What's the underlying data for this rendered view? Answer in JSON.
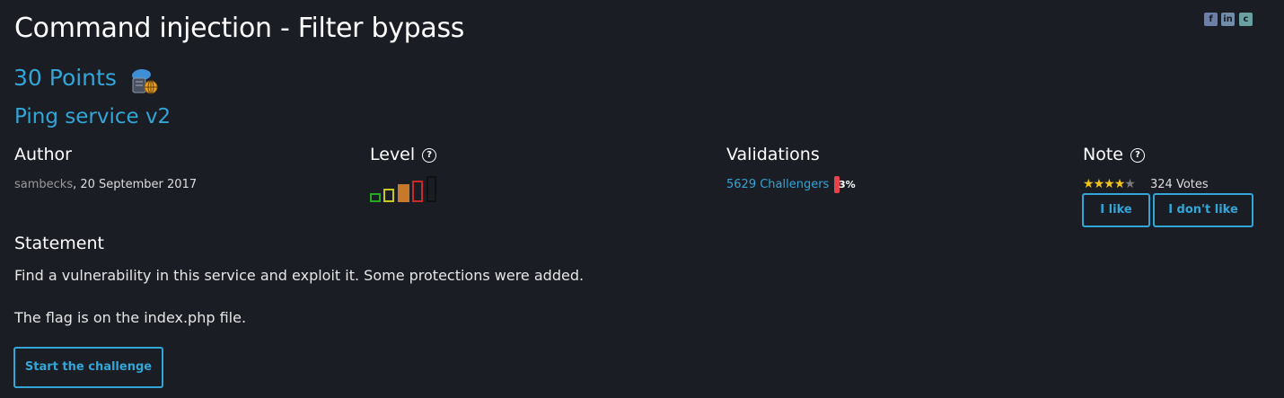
{
  "challenge": {
    "title": "Command injection - Filter bypass",
    "points": "30 Points",
    "category_icon": "cloud-network-icon",
    "subtitle": "Ping service v2"
  },
  "share": {
    "facebook": "f",
    "linkedin": "in",
    "other": "c"
  },
  "author": {
    "heading": "Author",
    "name": "sambecks",
    "date": ",  20 September 2017"
  },
  "level": {
    "heading": "Level",
    "help": "?",
    "value": 3,
    "max": 5,
    "colors": [
      "#22aa22",
      "#c8c820",
      "#c8782a",
      "#c82a2a",
      "#111111"
    ]
  },
  "validations": {
    "heading": "Validations",
    "challengers": "5629 Challengers",
    "percent": "3%"
  },
  "note": {
    "heading": "Note",
    "help": "?",
    "rating": 4,
    "max": 5,
    "votes": "324 Votes",
    "like_label": "I like",
    "dislike_label": "I don't like"
  },
  "statement": {
    "heading": "Statement",
    "line1": "Find a vulnerability in this service and exploit it. Some protections were added.",
    "line2": "The flag is on the index.php file.",
    "start_label": "Start the challenge"
  }
}
